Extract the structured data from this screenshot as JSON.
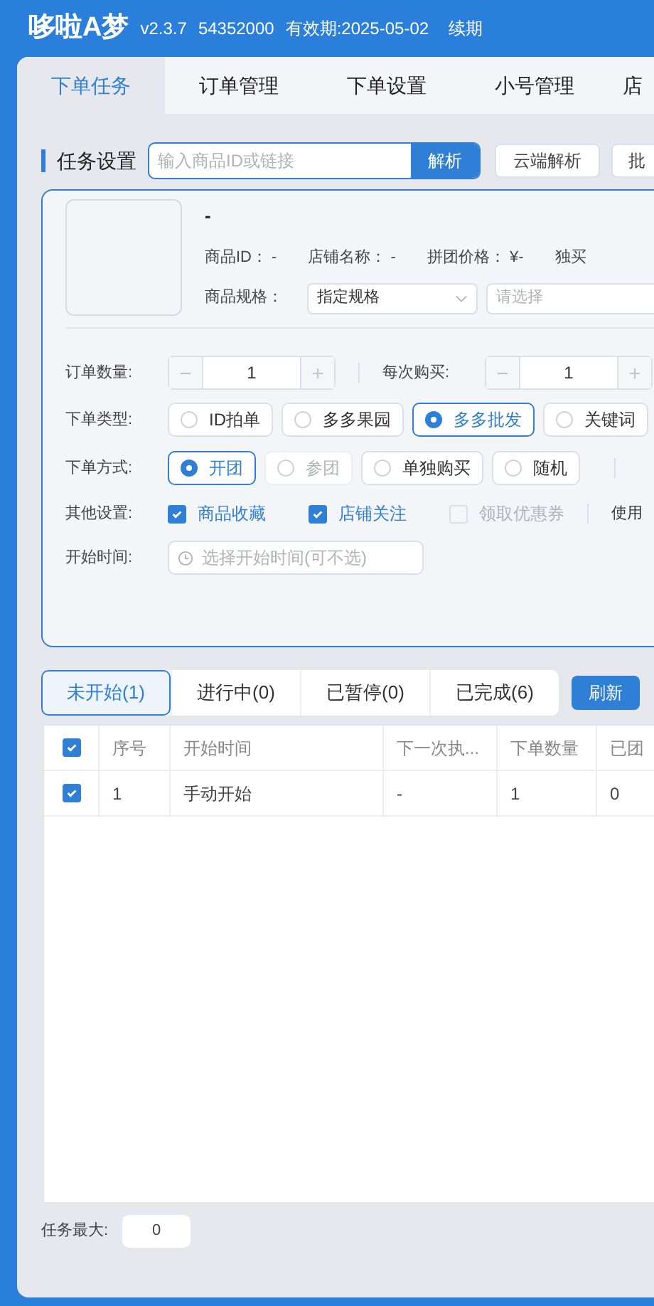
{
  "header": {
    "title": "哆啦A梦",
    "version": "v2.3.7",
    "account": "54352000",
    "expiry": "有效期:2025-05-02",
    "renew": "续期"
  },
  "tabs": [
    {
      "label": "下单任务",
      "selected": true
    },
    {
      "label": "订单管理",
      "selected": false
    },
    {
      "label": "下单设置",
      "selected": false
    },
    {
      "label": "小号管理",
      "selected": false
    },
    {
      "label": "店",
      "selected": false
    }
  ],
  "task_settings": {
    "title": "任务设置",
    "search_placeholder": "输入商品ID或链接",
    "parse_button": "解析",
    "cloud_button": "云端解析",
    "batch_button": "批"
  },
  "product": {
    "name": "-",
    "fields": [
      {
        "label": "商品ID：",
        "value": "-"
      },
      {
        "label": "店铺名称：",
        "value": "-"
      },
      {
        "label": "拼团价格：",
        "value": "¥-"
      },
      {
        "label": "独买"
      }
    ],
    "spec_label": "商品规格：",
    "spec_value": "指定规格",
    "spec_placeholder": "请选择"
  },
  "order_qty": {
    "label": "订单数量:",
    "value": "1"
  },
  "per_buy": {
    "label": "每次购买:",
    "value": "1"
  },
  "order_type": {
    "label": "下单类型:",
    "options": [
      {
        "label": "ID拍单",
        "selected": false
      },
      {
        "label": "多多果园",
        "selected": false
      },
      {
        "label": "多多批发",
        "selected": true
      },
      {
        "label": "关键词",
        "selected": false
      }
    ]
  },
  "order_method": {
    "label": "下单方式:",
    "options": [
      {
        "label": "开团",
        "selected": true,
        "disabled": false
      },
      {
        "label": "参团",
        "selected": false,
        "disabled": true
      },
      {
        "label": "单独购买",
        "selected": false,
        "disabled": false
      },
      {
        "label": "随机",
        "selected": false,
        "disabled": false
      }
    ]
  },
  "other_settings": {
    "label": "其他设置:",
    "options": [
      {
        "label": "商品收藏",
        "checked": true,
        "disabled": false
      },
      {
        "label": "店铺关注",
        "checked": true,
        "disabled": false
      },
      {
        "label": "领取优惠券",
        "checked": false,
        "disabled": true
      }
    ],
    "trailing": "使用"
  },
  "start_time": {
    "label": "开始时间:",
    "placeholder": "选择开始时间(可不选)"
  },
  "status_tabs": [
    {
      "label": "未开始(1)",
      "selected": true
    },
    {
      "label": "进行中(0)",
      "selected": false
    },
    {
      "label": "已暂停(0)",
      "selected": false
    },
    {
      "label": "已完成(6)",
      "selected": false
    }
  ],
  "refresh_button": "刷新",
  "table": {
    "header_checked": true,
    "columns": [
      "序号",
      "开始时间",
      "下一次执...",
      "下单数量",
      "已团"
    ],
    "rows": [
      {
        "checked": true,
        "cells": [
          "1",
          "手动开始",
          "-",
          "1",
          "0"
        ]
      }
    ]
  },
  "footer": {
    "label": "任务最大:",
    "value": "0"
  }
}
